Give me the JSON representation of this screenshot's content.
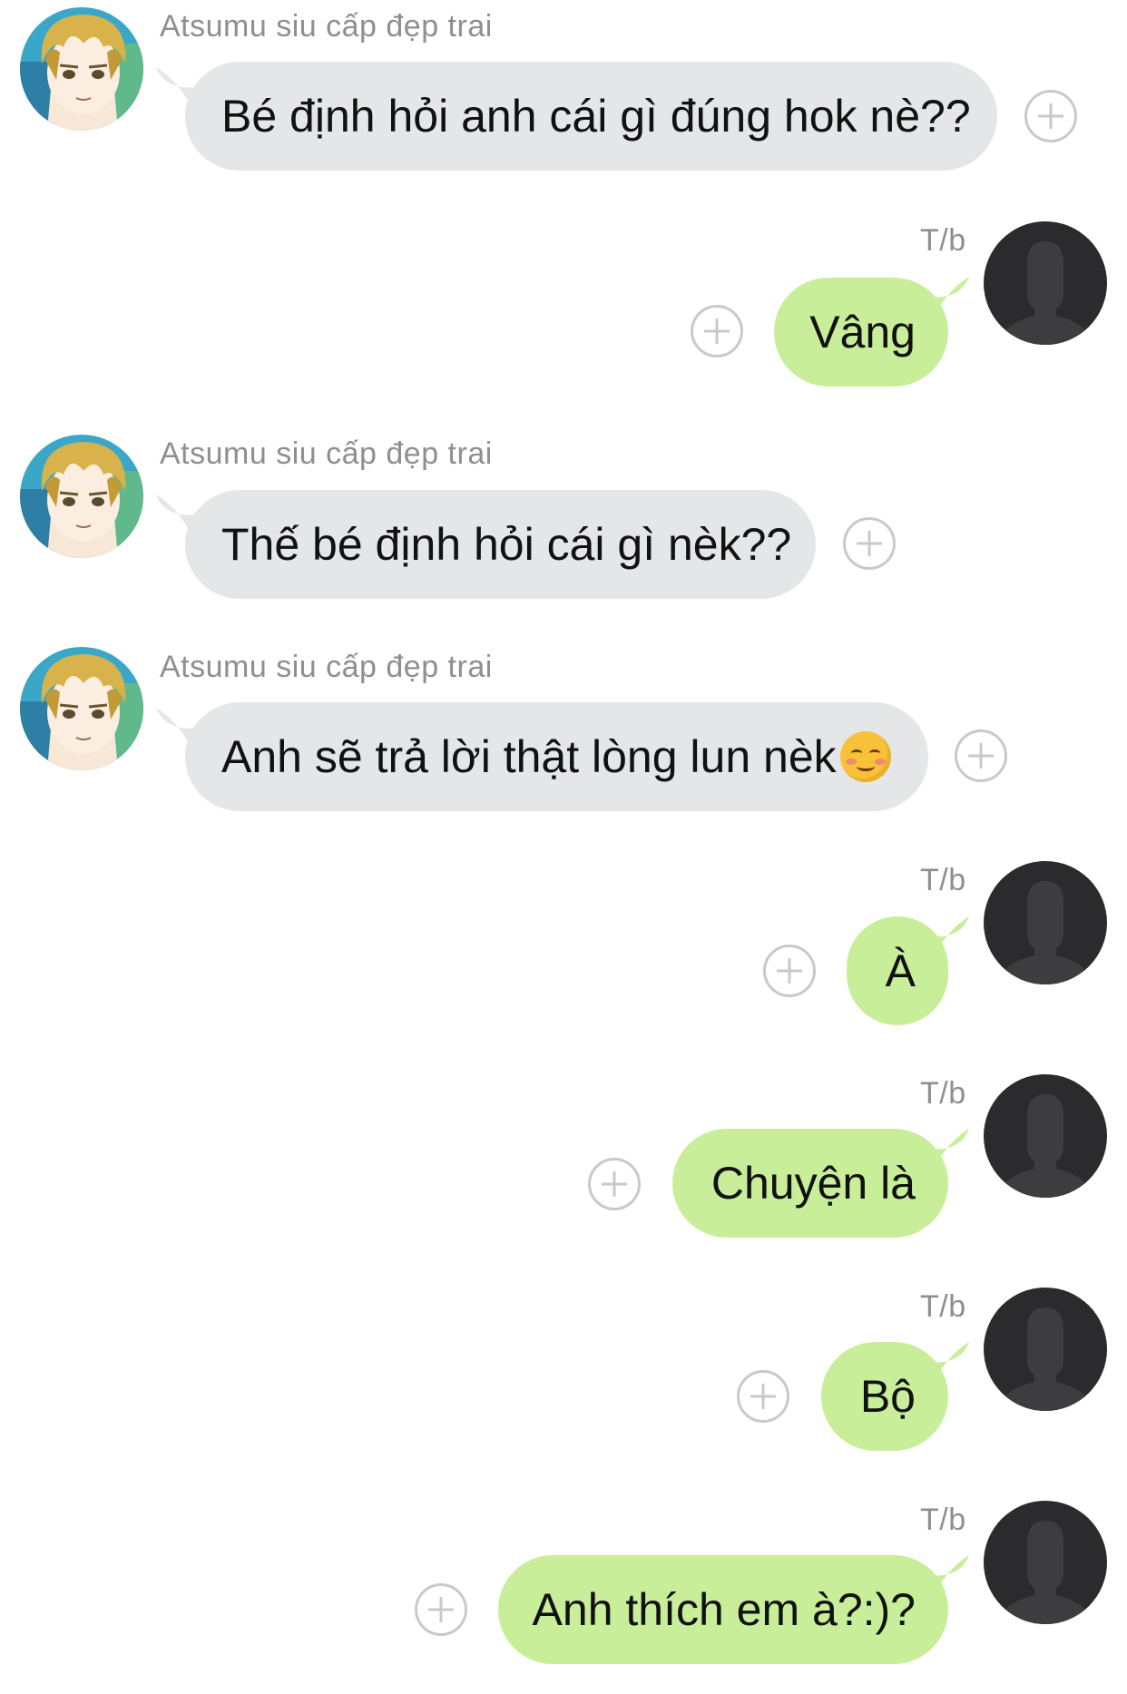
{
  "chat": {
    "messages": [
      {
        "direction": "incoming",
        "sender": "Atsumu siu cấp đẹp trai",
        "text": "Bé định hỏi anh cái gì đúng hok nè??"
      },
      {
        "direction": "outgoing",
        "sender": "T/b",
        "text": "Vâng"
      },
      {
        "direction": "incoming",
        "sender": "Atsumu siu cấp đẹp trai",
        "text": "Thế bé định hỏi cái gì nèk??"
      },
      {
        "direction": "incoming",
        "sender": "Atsumu siu cấp đẹp trai",
        "text": "Anh sẽ trả lời thật lòng lun nèk",
        "emoji": "smiling-face-icon"
      },
      {
        "direction": "outgoing",
        "sender": "T/b",
        "text": "À"
      },
      {
        "direction": "outgoing",
        "sender": "T/b",
        "text": "Chuyện là"
      },
      {
        "direction": "outgoing",
        "sender": "T/b",
        "text": "Bộ"
      },
      {
        "direction": "outgoing",
        "sender": "T/b",
        "text": "Anh thích em à?:)?"
      }
    ]
  },
  "colors": {
    "incoming_bubble": "#e5e6e8",
    "outgoing_bubble": "#c8ee9a",
    "sender_name": "#8e8e93",
    "add_reaction_icon": "#c9c9cc"
  },
  "icons": {
    "incoming_avatar": "anime-character-avatar-icon",
    "outgoing_avatar": "default-person-silhouette-icon",
    "reaction": "add-reaction-plus-icon"
  }
}
